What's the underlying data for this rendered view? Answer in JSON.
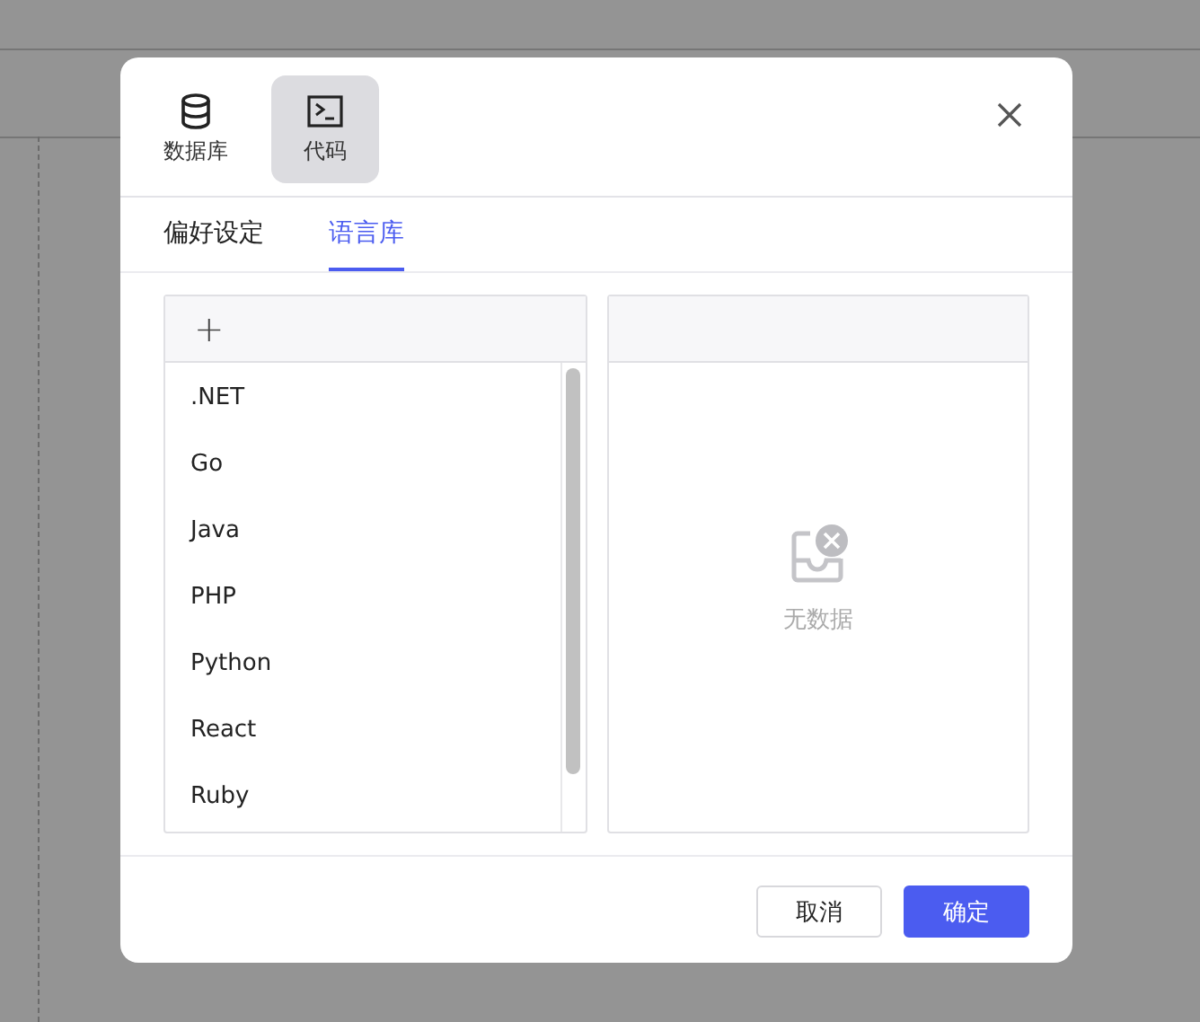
{
  "dialog": {
    "categories": [
      {
        "kind": "database",
        "label": "数据库",
        "selected": false
      },
      {
        "kind": "code",
        "label": "代码",
        "selected": true
      }
    ],
    "tabs": [
      {
        "label": "偏好设定",
        "selected": false
      },
      {
        "label": "语言库",
        "selected": true
      }
    ],
    "left_panel": {
      "add_button": "+",
      "items": [
        ".NET",
        "Go",
        "Java",
        "PHP",
        "Python",
        "React",
        "Ruby"
      ]
    },
    "right_panel": {
      "empty_text": "无数据"
    },
    "buttons": [
      {
        "kind": "secondary",
        "label": "取消"
      },
      {
        "kind": "primary",
        "label": "确定"
      }
    ]
  }
}
